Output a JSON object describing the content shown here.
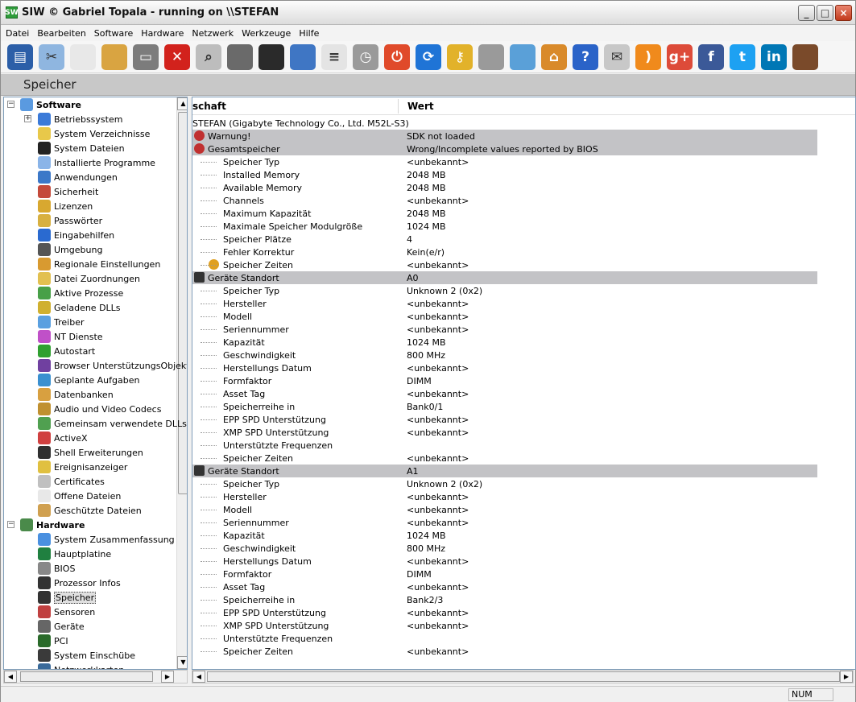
{
  "window": {
    "title": "SIW  © Gabriel Topala - running on \\\\STEFAN",
    "app_icon": "SW"
  },
  "menu": [
    "Datei",
    "Bearbeiten",
    "Software",
    "Hardware",
    "Netzwerk",
    "Werkzeuge",
    "Hilfe"
  ],
  "toolbar_icons": [
    "save-icon",
    "cut-icon",
    "copy-icon",
    "paste-icon",
    "print-icon",
    "stop-icon",
    "search-icon",
    "compass-icon",
    "monitor-icon",
    "network-icon",
    "list-icon",
    "stopwatch-icon",
    "power-icon",
    "refresh-icon",
    "key-icon",
    "tools-icon",
    "wizard-icon",
    "home-icon",
    "help-icon",
    "mail-icon",
    "rss-icon",
    "googleplus-icon",
    "facebook-icon",
    "twitter-icon",
    "linkedin-icon",
    "coffee-icon"
  ],
  "toolbar_glyphs": {
    "googleplus": "g+",
    "facebook": "f",
    "linkedin": "in"
  },
  "page_title": "Speicher",
  "tree": {
    "software_label": "Software",
    "software_items": [
      "Betriebssystem",
      "System Verzeichnisse",
      "System Dateien",
      "Installierte Programme",
      "Anwendungen",
      "Sicherheit",
      "Lizenzen",
      "Passwörter",
      "Eingabehilfen",
      "Umgebung",
      "Regionale Einstellungen",
      "Datei Zuordnungen",
      "Aktive Prozesse",
      "Geladene DLLs",
      "Treiber",
      "NT Dienste",
      "Autostart",
      "Browser UnterstützungsObjekt",
      "Geplante Aufgaben",
      "Datenbanken",
      "Audio und Video Codecs",
      "Gemeinsam verwendete DLLs",
      "ActiveX",
      "Shell Erweiterungen",
      "Ereignisanzeiger",
      "Certificates",
      "Offene Dateien",
      "Geschützte Dateien"
    ],
    "hardware_label": "Hardware",
    "hardware_items": [
      "System Zusammenfassung",
      "Hauptplatine",
      "BIOS",
      "Prozessor Infos",
      "Speicher",
      "Sensoren",
      "Geräte",
      "PCI",
      "System Einschübe",
      "Netzwerkkarten"
    ],
    "selected": "Speicher"
  },
  "columns": {
    "property": "Eigenschaft",
    "value": "Wert",
    "property_visible": "schaft"
  },
  "rows": [
    {
      "p": "STEFAN (Gigabyte Technology Co., Ltd. M52L-S3)",
      "v": "",
      "kind": "root"
    },
    {
      "p": "Warnung!",
      "v": "SDK not loaded",
      "kind": "group-warn"
    },
    {
      "p": "Gesamtspeicher",
      "v": "Wrong/Incomplete values reported by BIOS",
      "kind": "group-warn"
    },
    {
      "p": "Speicher Typ",
      "v": "<unbekannt>",
      "kind": "item"
    },
    {
      "p": "Installed Memory",
      "v": "2048 MB",
      "kind": "item"
    },
    {
      "p": "Available Memory",
      "v": "2048 MB",
      "kind": "item"
    },
    {
      "p": "Channels",
      "v": "<unbekannt>",
      "kind": "item"
    },
    {
      "p": "Maximum Kapazität",
      "v": "2048 MB",
      "kind": "item"
    },
    {
      "p": "Maximale Speicher Modulgröße",
      "v": "1024 MB",
      "kind": "item"
    },
    {
      "p": "Speicher Plätze",
      "v": "4",
      "kind": "item"
    },
    {
      "p": "Fehler Korrektur",
      "v": "Kein(e/r)",
      "kind": "item"
    },
    {
      "p": "Speicher Zeiten",
      "v": "<unbekannt>",
      "kind": "item-info"
    },
    {
      "p": "Geräte Standort",
      "v": "A0",
      "kind": "group-mem"
    },
    {
      "p": "Speicher Typ",
      "v": "Unknown 2 (0x2)",
      "kind": "item"
    },
    {
      "p": "Hersteller",
      "v": "<unbekannt>",
      "kind": "item"
    },
    {
      "p": "Modell",
      "v": "<unbekannt>",
      "kind": "item"
    },
    {
      "p": "Seriennummer",
      "v": "<unbekannt>",
      "kind": "item"
    },
    {
      "p": "Kapazität",
      "v": "1024 MB",
      "kind": "item"
    },
    {
      "p": "Geschwindigkeit",
      "v": "800 MHz",
      "kind": "item"
    },
    {
      "p": "Herstellungs Datum",
      "v": "<unbekannt>",
      "kind": "item"
    },
    {
      "p": "Formfaktor",
      "v": "DIMM",
      "kind": "item"
    },
    {
      "p": "Asset Tag",
      "v": "<unbekannt>",
      "kind": "item"
    },
    {
      "p": "Speicherreihe in",
      "v": "Bank0/1",
      "kind": "item"
    },
    {
      "p": "EPP SPD Unterstützung",
      "v": "<unbekannt>",
      "kind": "item"
    },
    {
      "p": "XMP SPD Unterstützung",
      "v": "<unbekannt>",
      "kind": "item"
    },
    {
      "p": "Unterstützte Frequenzen",
      "v": "",
      "kind": "item"
    },
    {
      "p": "Speicher Zeiten",
      "v": "<unbekannt>",
      "kind": "item"
    },
    {
      "p": "Geräte Standort",
      "v": "A1",
      "kind": "group-mem"
    },
    {
      "p": "Speicher Typ",
      "v": "Unknown 2 (0x2)",
      "kind": "item"
    },
    {
      "p": "Hersteller",
      "v": "<unbekannt>",
      "kind": "item"
    },
    {
      "p": "Modell",
      "v": "<unbekannt>",
      "kind": "item"
    },
    {
      "p": "Seriennummer",
      "v": "<unbekannt>",
      "kind": "item"
    },
    {
      "p": "Kapazität",
      "v": "1024 MB",
      "kind": "item"
    },
    {
      "p": "Geschwindigkeit",
      "v": "800 MHz",
      "kind": "item"
    },
    {
      "p": "Herstellungs Datum",
      "v": "<unbekannt>",
      "kind": "item"
    },
    {
      "p": "Formfaktor",
      "v": "DIMM",
      "kind": "item"
    },
    {
      "p": "Asset Tag",
      "v": "<unbekannt>",
      "kind": "item"
    },
    {
      "p": "Speicherreihe in",
      "v": "Bank2/3",
      "kind": "item"
    },
    {
      "p": "EPP SPD Unterstützung",
      "v": "<unbekannt>",
      "kind": "item"
    },
    {
      "p": "XMP SPD Unterstützung",
      "v": "<unbekannt>",
      "kind": "item"
    },
    {
      "p": "Unterstützte Frequenzen",
      "v": "",
      "kind": "item"
    },
    {
      "p": "Speicher Zeiten",
      "v": "<unbekannt>",
      "kind": "item"
    }
  ],
  "status": {
    "num": "NUM"
  }
}
